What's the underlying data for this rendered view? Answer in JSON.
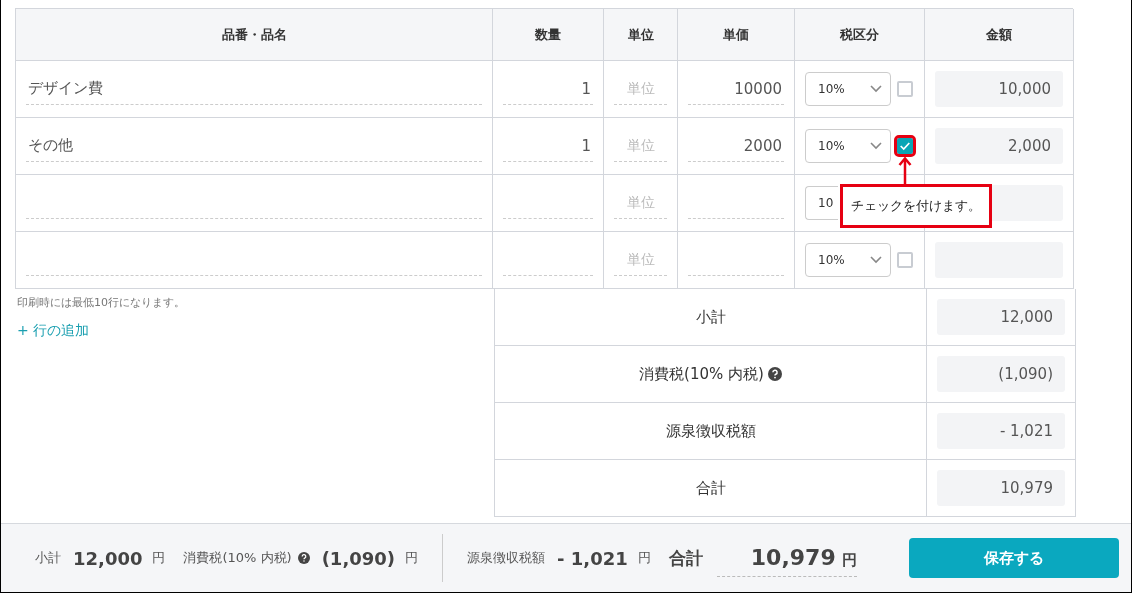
{
  "table": {
    "columns": [
      "品番・品名",
      "数量",
      "単位",
      "単価",
      "税区分",
      "金額"
    ],
    "rows": [
      {
        "name": "デザイン費",
        "quantity": "1",
        "unit_placeholder": "単位",
        "price": "10000",
        "tax": "10%",
        "withholding": {
          "checked": false,
          "highlighted": false
        },
        "amount": "10,000"
      },
      {
        "name": "その他",
        "quantity": "1",
        "unit_placeholder": "単位",
        "price": "2000",
        "tax": "10%",
        "withholding": {
          "checked": true,
          "highlighted": true
        },
        "amount": "2,000"
      },
      {
        "unit_placeholder": "単位",
        "tax": "10"
      },
      {
        "unit_placeholder": "単位",
        "tax": "10%",
        "withholding": {
          "checked": false,
          "highlighted": false
        }
      }
    ]
  },
  "callout": {
    "text": "チェックを付けます。"
  },
  "print_note": "印刷時には最低10行になります。",
  "add_row_link": "+ 行の追加",
  "summary": [
    {
      "label": "小計",
      "help": false,
      "value": "12,000"
    },
    {
      "label": "消費税(10% 内税)",
      "help": true,
      "value": "(1,090)"
    },
    {
      "label": "源泉徴収税額",
      "help": false,
      "value": "- 1,021"
    },
    {
      "label": "合計",
      "help": false,
      "value": "10,979"
    }
  ],
  "footer": {
    "items": [
      {
        "kind": "small",
        "label": "小計",
        "help": false,
        "value": "12,000",
        "unit": "円"
      },
      {
        "kind": "small",
        "label": "消費税(10% 内税)",
        "help": true,
        "value": "(1,090)",
        "unit": "円"
      },
      {
        "kind": "small",
        "label": "源泉徴収税額",
        "help": false,
        "value": "- 1,021",
        "unit": "円"
      },
      {
        "kind": "total",
        "label": "合計",
        "help": false,
        "value": "10,979",
        "unit": "円"
      }
    ],
    "save_button": "保存する"
  }
}
